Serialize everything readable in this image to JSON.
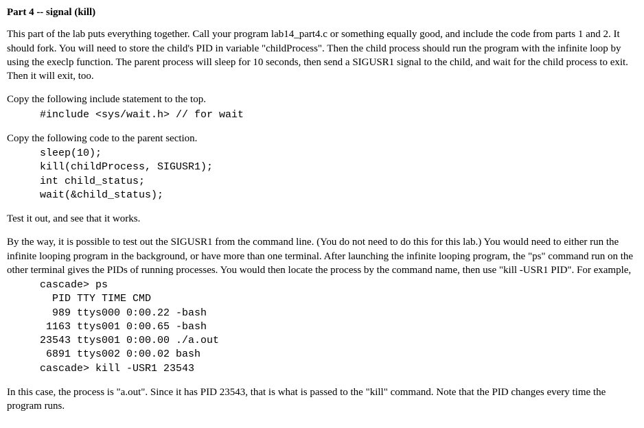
{
  "heading": "Part 4 -- signal (kill)",
  "para1": "This part of the lab puts everything together. Call your program lab14_part4.c or something equally good, and include the code from parts 1 and 2. It should fork. You will need to store the child's PID in variable \"childProcess\". Then the child process should run the program with the infinite loop by using the execlp function. The parent process will sleep for 10 seconds, then send a SIGUSR1 signal to the child, and wait for the child process to exit. Then it will exit, too.",
  "para2": "Copy the following include statement to the top.",
  "code1": "#include <sys/wait.h> // for wait",
  "para3": "Copy the following code to the parent section.",
  "code2": "sleep(10);\nkill(childProcess, SIGUSR1);\nint child_status;\nwait(&child_status);",
  "para4": "Test it out, and see that it works.",
  "para5": "By the way, it is possible to test out the SIGUSR1 from the command line. (You do not need to do this for this lab.) You would need to either run the infinite looping program in the background, or have more than one terminal. After launching the infinite looping program, the \"ps\" command run on the other terminal gives the PIDs of running processes. You would then locate the process by the command name, then use \"kill -USR1 PID\". For example,",
  "code3": "cascade> ps\n  PID TTY TIME CMD\n  989 ttys000 0:00.22 -bash\n 1163 ttys001 0:00.65 -bash\n23543 ttys001 0:00.00 ./a.out\n 6891 ttys002 0:00.02 bash\ncascade> kill -USR1 23543",
  "para6": "In this case, the process is \"a.out\". Since it has PID 23543, that is what is passed to the \"kill\" command. Note that the PID changes every time the program runs."
}
